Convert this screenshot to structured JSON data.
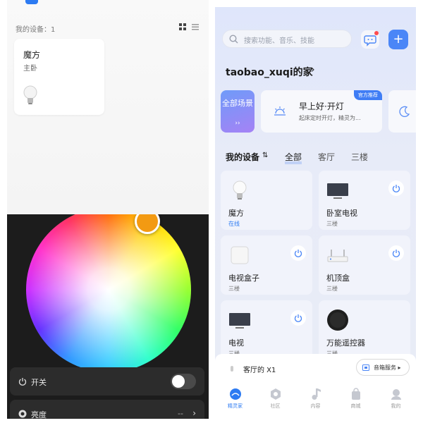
{
  "left_top": {
    "device_count_label": "我的设备：1",
    "card": {
      "name": "魔方",
      "room": "主卧"
    }
  },
  "left_bottom": {
    "power_label": "开关",
    "brightness_label": "亮度",
    "brightness_value": "--",
    "knob_color": "#f39a12"
  },
  "right": {
    "status_text": "",
    "search_placeholder": "搜索功能、音乐、技能",
    "home_title": "taobao_xuqi的家",
    "scene_all_label": "全部场景",
    "scene_all_arrow": "››",
    "scene": {
      "badge": "官方推荐",
      "title": "早上好·开灯",
      "desc": "起床定时开灯，精灵为..."
    },
    "tabs": {
      "my_devices": "我的设备",
      "sort_icon": "⇅",
      "all": "全部",
      "living_room": "客厅",
      "floor3": "三楼"
    },
    "devices": [
      {
        "name": "魔方",
        "sub": "在线",
        "icon": "bulb-icon"
      },
      {
        "name": "卧室电视",
        "sub": "三楼",
        "icon": "tv-icon"
      },
      {
        "name": "电视盒子",
        "sub": "三楼",
        "icon": "tv-box-icon"
      },
      {
        "name": "机顶盒",
        "sub": "三楼",
        "icon": "set-top-box-icon"
      },
      {
        "name": "电视",
        "sub": "三楼",
        "icon": "tv-icon"
      },
      {
        "name": "万能遥控器",
        "sub": "三楼",
        "icon": "remote-hub-icon"
      }
    ],
    "bottom_sheet": {
      "device": "客厅的  X1",
      "button": "音箱服务 ▸"
    },
    "tabbar": [
      {
        "label": "精灵家",
        "active": true
      },
      {
        "label": "社区",
        "active": false
      },
      {
        "label": "内容",
        "active": false
      },
      {
        "label": "商城",
        "active": false
      },
      {
        "label": "我的",
        "active": false
      }
    ],
    "accent_color": "#2d7bf2"
  }
}
